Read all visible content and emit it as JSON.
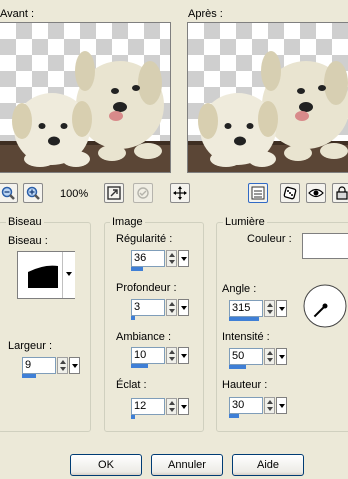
{
  "preview": {
    "before_label": "Avant :",
    "after_label": "Après :"
  },
  "toolbar": {
    "zoom_level": "100%",
    "icons": [
      "zoom-out-icon",
      "zoom-in-icon",
      "fit-icon",
      "proof-icon",
      "pan-icon",
      "settings-icon",
      "randomize-icon",
      "eye-icon",
      "lock-icon"
    ]
  },
  "biseau": {
    "group_title": "Biseau",
    "shape_label": "Biseau :",
    "width_label": "Largeur :",
    "width_value": "9",
    "width_fill": 0.4
  },
  "image": {
    "group_title": "Image",
    "fields": [
      {
        "label": "Régularité :",
        "value": "36",
        "fill": 0.36
      },
      {
        "label": "Profondeur :",
        "value": "3",
        "fill": 0.12
      },
      {
        "label": "Ambiance :",
        "value": "10",
        "fill": 0.5
      },
      {
        "label": "Éclat :",
        "value": "12",
        "fill": 0.12
      }
    ]
  },
  "lumiere": {
    "group_title": "Lumière",
    "color_label": "Couleur :",
    "color_value": "#ffffff",
    "angle_label": "Angle :",
    "angle_value": "315",
    "angle_fill": 0.88,
    "intensity_label": "Intensité :",
    "intensity_value": "50",
    "intensity_fill": 0.5,
    "height_label": "Hauteur :",
    "height_value": "30",
    "height_fill": 0.3
  },
  "buttons": {
    "ok": "OK",
    "cancel": "Annuler",
    "help": "Aide"
  }
}
